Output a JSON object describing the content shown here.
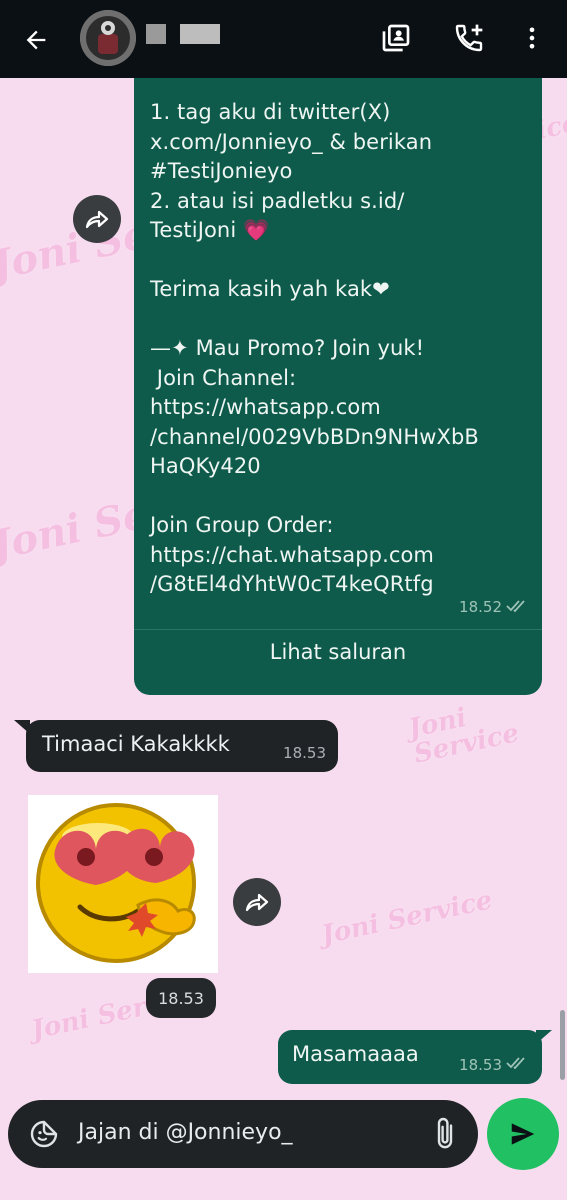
{
  "header": {
    "back_icon": "arrow-left-icon",
    "contact_avatar": "avatar",
    "icons": [
      "contact-card-icon",
      "add-call-icon",
      "more-vert-icon"
    ]
  },
  "wallpaper": {
    "watermark_text": "Joni Service"
  },
  "messages": {
    "forwarded_channel": {
      "text": "1. tag aku di twitter(X)\nx.com/Jonnieyo_ & berikan\n#TestiJonieyo\n2. atau isi padletku s.id/\nTestiJoni 💗\n\nTerima kasih yah kak❤\n\n—✦ Mau Promo? Join yuk!\n Join Channel:\nhttps://whatsapp.com\n/channel/0029VbBDn9NHwXbB\nHaQKy420\n\nJoin Group Order:\nhttps://chat.whatsapp.com\n/G8tEl4dYhtW0cT4keQRtfg",
      "time": "18.52",
      "action_label": "Lihat saluran"
    },
    "incoming_text": {
      "text": "Timaaci Kakakkkk",
      "time": "18.53"
    },
    "sticker": {
      "time": "18.53"
    },
    "outgoing_text": {
      "text": "Masamaaaa",
      "time": "18.53"
    }
  },
  "composer": {
    "value": "Jajan di @Jonnieyo_",
    "send_icon": "send-icon"
  },
  "colors": {
    "header_bg": "#0b1014",
    "outgoing_bubble": "#0e5b4b",
    "incoming_bubble": "#1f2326",
    "send_button": "#21c063",
    "wallpaper": "#f7dcef"
  }
}
